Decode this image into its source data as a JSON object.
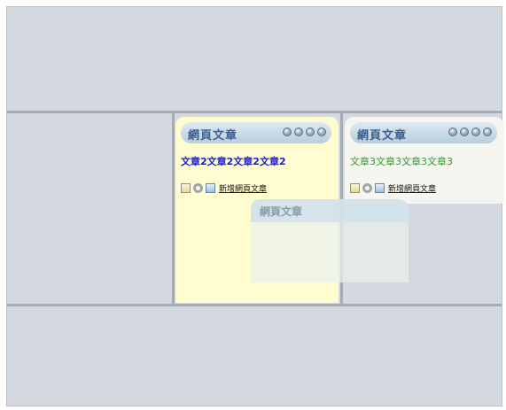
{
  "colors": {
    "frame_bg": "#d3d9de",
    "divider": "#a5adb3",
    "widget1_bg": "#fffdd0",
    "widget2_bg": "#f6f6f0",
    "widget1_text": "#1c1cd6",
    "widget2_text": "#2e9a2e",
    "title_color": "#3a5f8c"
  },
  "widgets": [
    {
      "title": "網頁文章",
      "content": "文章2文章2文章2文章2",
      "new_link": "新增網頁文章",
      "icons": [
        "edit-icon",
        "gear-icon",
        "doc-icon"
      ]
    },
    {
      "title": "網頁文章",
      "content": "文章3文章3文章3文章3",
      "new_link": "新增網頁文章",
      "icons": [
        "edit-icon",
        "gear-icon",
        "doc-icon"
      ]
    }
  ],
  "drag_ghost": {
    "title": "網頁文章"
  }
}
